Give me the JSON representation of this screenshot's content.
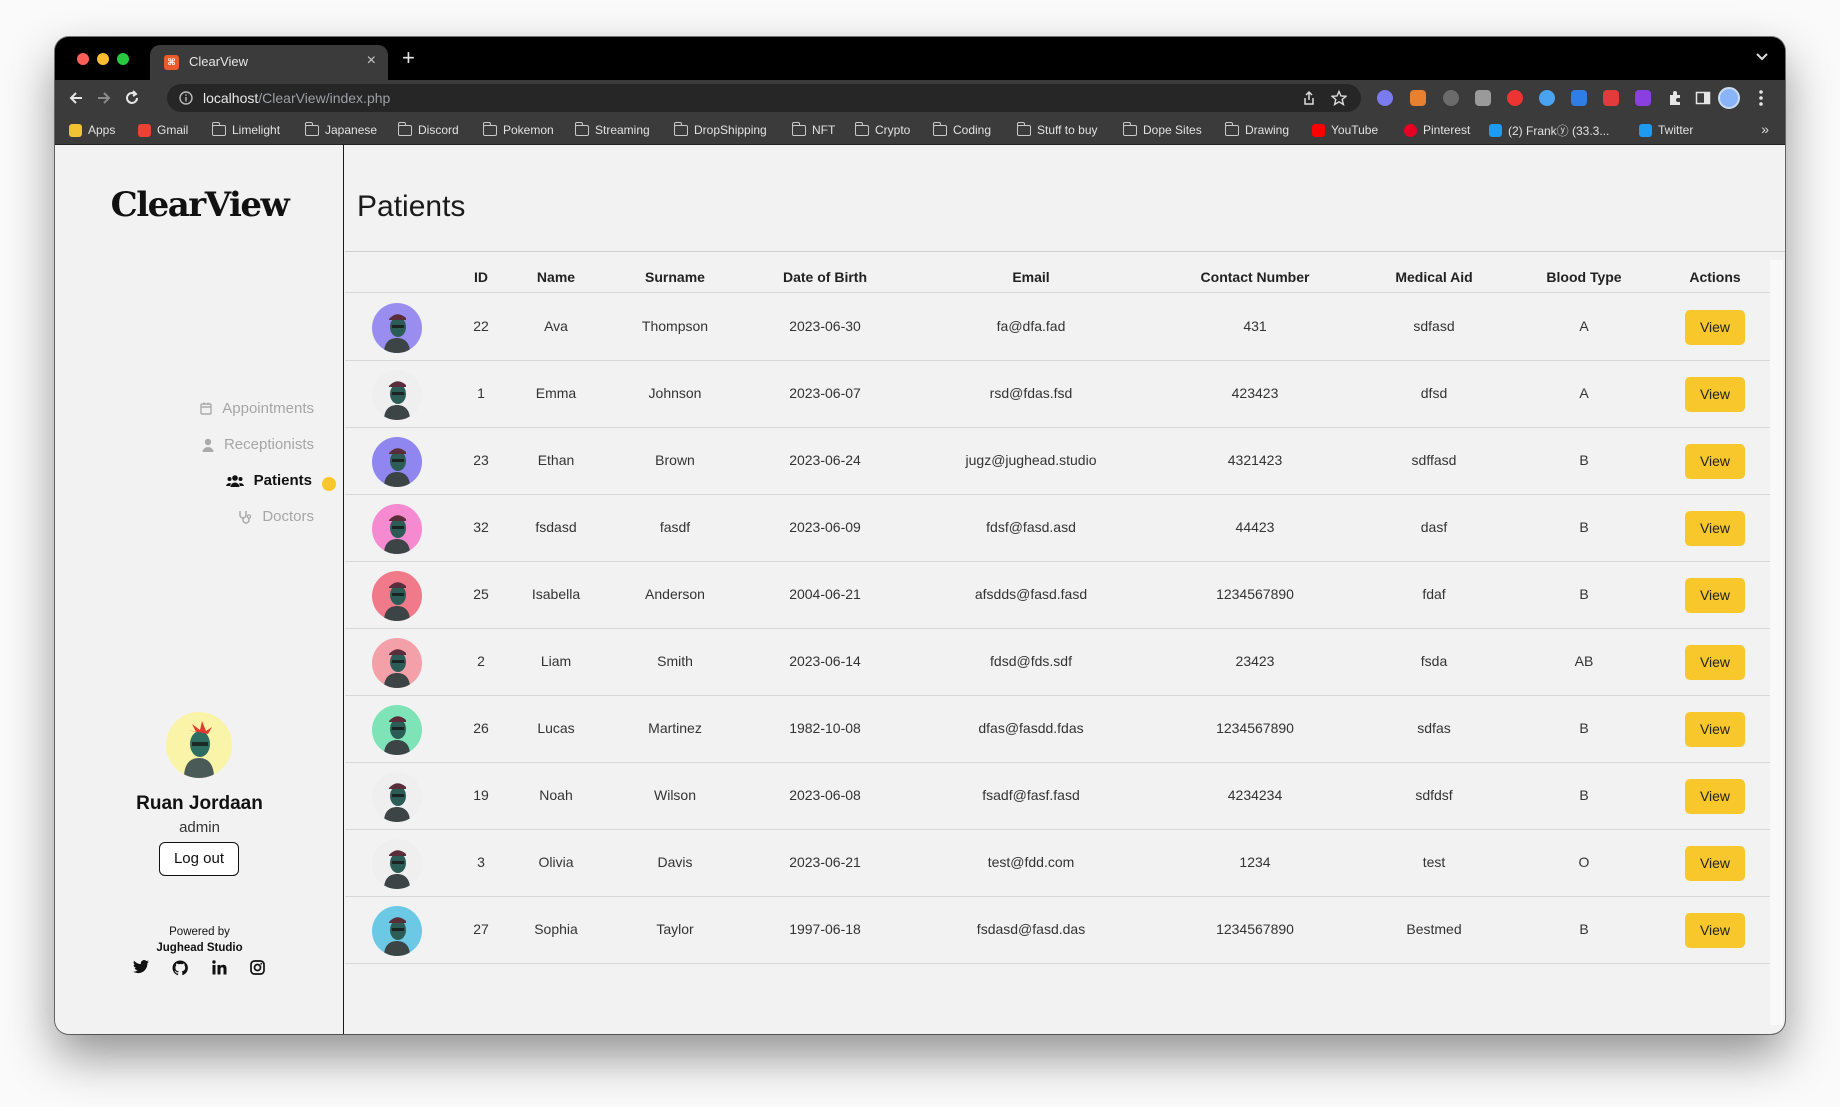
{
  "browser": {
    "tab_title": "ClearView",
    "url_host": "localhost",
    "url_path": "/ClearView/index.php",
    "bookmarks": [
      {
        "label": "Apps",
        "icon": "apps-grid-icon"
      },
      {
        "label": "Gmail",
        "icon": "gmail-icon"
      },
      {
        "label": "Limelight",
        "icon": "folder-icon"
      },
      {
        "label": "Japanese",
        "icon": "folder-icon"
      },
      {
        "label": "Discord",
        "icon": "folder-icon"
      },
      {
        "label": "Pokemon",
        "icon": "folder-icon"
      },
      {
        "label": "Streaming",
        "icon": "folder-icon"
      },
      {
        "label": "DropShipping",
        "icon": "folder-icon"
      },
      {
        "label": "NFT",
        "icon": "folder-icon"
      },
      {
        "label": "Crypto",
        "icon": "folder-icon"
      },
      {
        "label": "Coding",
        "icon": "folder-icon"
      },
      {
        "label": "Stuff to buy",
        "icon": "folder-icon"
      },
      {
        "label": "Dope Sites",
        "icon": "folder-icon"
      },
      {
        "label": "Drawing",
        "icon": "folder-icon"
      },
      {
        "label": "YouTube",
        "icon": "youtube-icon"
      },
      {
        "label": "Pinterest",
        "icon": "pinterest-icon"
      },
      {
        "label": "(2) Frankⓨ (33.3...",
        "icon": "twitter-icon"
      },
      {
        "label": "Twitter",
        "icon": "twitter-icon"
      }
    ]
  },
  "sidebar": {
    "logo": "ClearView",
    "nav": [
      {
        "label": "Appointments",
        "icon": "calendar-icon",
        "active": false
      },
      {
        "label": "Receptionists",
        "icon": "user-icon",
        "active": false
      },
      {
        "label": "Patients",
        "icon": "users-icon",
        "active": true
      },
      {
        "label": "Doctors",
        "icon": "stethoscope-icon",
        "active": false
      }
    ],
    "user": {
      "name": "Ruan Jordaan",
      "role": "admin"
    },
    "logout_label": "Log out",
    "powered_by": "Powered by",
    "studio": "Jughead Studio",
    "socials": [
      "twitter-icon",
      "github-icon",
      "linkedin-icon",
      "instagram-icon"
    ]
  },
  "main": {
    "title": "Patients",
    "add_button_icon": "user-plus-icon",
    "columns": [
      "ID",
      "Name",
      "Surname",
      "Date of Birth",
      "Email",
      "Contact Number",
      "Medical Aid",
      "Blood Type",
      "Actions"
    ],
    "action_label": "View",
    "patients": [
      {
        "id": "22",
        "name": "Ava",
        "surname": "Thompson",
        "dob": "2023-06-30",
        "email": "fa@dfa.fad",
        "contact": "431",
        "aid": "sdfasd",
        "blood": "A",
        "avatar_bg": "#9a8df0"
      },
      {
        "id": "1",
        "name": "Emma",
        "surname": "Johnson",
        "dob": "2023-06-07",
        "email": "rsd@fdas.fsd",
        "contact": "423423",
        "aid": "dfsd",
        "blood": "A",
        "avatar_bg": "#efefef"
      },
      {
        "id": "23",
        "name": "Ethan",
        "surname": "Brown",
        "dob": "2023-06-24",
        "email": "jugz@jughead.studio",
        "contact": "4321423",
        "aid": "sdffasd",
        "blood": "B",
        "avatar_bg": "#8f86ef"
      },
      {
        "id": "32",
        "name": "fsdasd",
        "surname": "fasdf",
        "dob": "2023-06-09",
        "email": "fdsf@fasd.asd",
        "contact": "44423",
        "aid": "dasf",
        "blood": "B",
        "avatar_bg": "#f58ad0"
      },
      {
        "id": "25",
        "name": "Isabella",
        "surname": "Anderson",
        "dob": "2004-06-21",
        "email": "afsdds@fasd.fasd",
        "contact": "1234567890",
        "aid": "fdaf",
        "blood": "B",
        "avatar_bg": "#f07a8a"
      },
      {
        "id": "2",
        "name": "Liam",
        "surname": "Smith",
        "dob": "2023-06-14",
        "email": "fdsd@fds.sdf",
        "contact": "23423",
        "aid": "fsda",
        "blood": "AB",
        "avatar_bg": "#f3a0a8"
      },
      {
        "id": "26",
        "name": "Lucas",
        "surname": "Martinez",
        "dob": "1982-10-08",
        "email": "dfas@fasdd.fdas",
        "contact": "1234567890",
        "aid": "sdfas",
        "blood": "B",
        "avatar_bg": "#7fe3b8"
      },
      {
        "id": "19",
        "name": "Noah",
        "surname": "Wilson",
        "dob": "2023-06-08",
        "email": "fsadf@fasf.fasd",
        "contact": "4234234",
        "aid": "sdfdsf",
        "blood": "B",
        "avatar_bg": "#efefef"
      },
      {
        "id": "3",
        "name": "Olivia",
        "surname": "Davis",
        "dob": "2023-06-21",
        "email": "test@fdd.com",
        "contact": "1234",
        "aid": "test",
        "blood": "O",
        "avatar_bg": "#efefef"
      },
      {
        "id": "27",
        "name": "Sophia",
        "surname": "Taylor",
        "dob": "1997-06-18",
        "email": "fsdasd@fasd.das",
        "contact": "1234567890",
        "aid": "Bestmed",
        "blood": "B",
        "avatar_bg": "#6cc9e6"
      }
    ]
  }
}
